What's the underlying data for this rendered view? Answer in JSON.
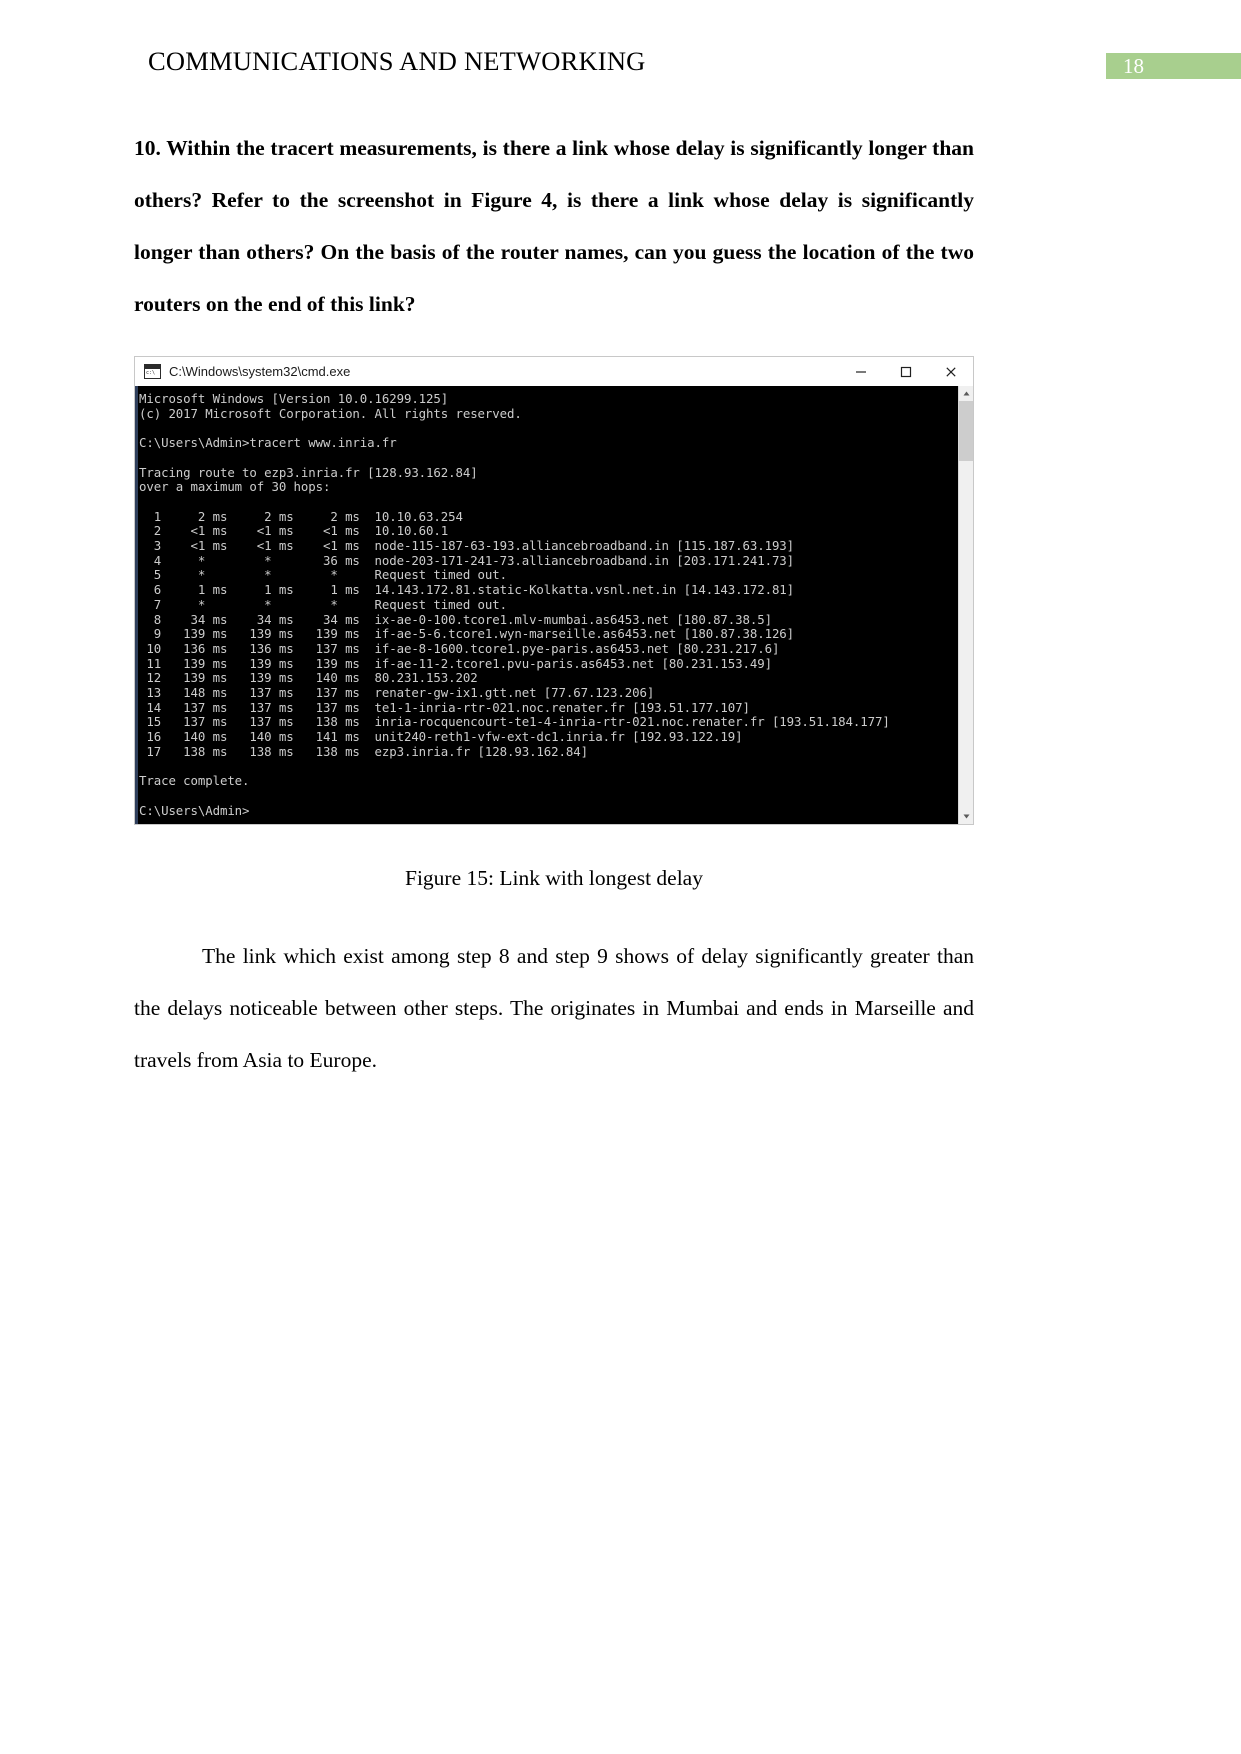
{
  "header": {
    "title": "COMMUNICATIONS AND NETWORKING",
    "page_number": "18",
    "badge_color": "#a8cf8e"
  },
  "question": {
    "text": "10. Within the tracert measurements, is there a link whose delay is significantly longer than others? Refer to the screenshot in Figure 4, is there a link whose delay is significantly longer than others? On the basis of the router names, can you guess the location of the two routers on the end of this link?"
  },
  "terminal": {
    "titlebar": {
      "icon": "cmd-icon",
      "title": "C:\\Windows\\system32\\cmd.exe",
      "minimize_label": "—",
      "maximize_label": "□",
      "close_label": "✕"
    },
    "console_text": "Microsoft Windows [Version 10.0.16299.125]\n(c) 2017 Microsoft Corporation. All rights reserved.\n\nC:\\Users\\Admin>tracert www.inria.fr\n\nTracing route to ezp3.inria.fr [128.93.162.84]\nover a maximum of 30 hops:\n\n  1     2 ms     2 ms     2 ms  10.10.63.254\n  2    <1 ms    <1 ms    <1 ms  10.10.60.1\n  3    <1 ms    <1 ms    <1 ms  node-115-187-63-193.alliancebroadband.in [115.187.63.193]\n  4     *        *       36 ms  node-203-171-241-73.alliancebroadband.in [203.171.241.73]\n  5     *        *        *     Request timed out.\n  6     1 ms     1 ms     1 ms  14.143.172.81.static-Kolkatta.vsnl.net.in [14.143.172.81]\n  7     *        *        *     Request timed out.\n  8    34 ms    34 ms    34 ms  ix-ae-0-100.tcore1.mlv-mumbai.as6453.net [180.87.38.5]\n  9   139 ms   139 ms   139 ms  if-ae-5-6.tcore1.wyn-marseille.as6453.net [180.87.38.126]\n 10   136 ms   136 ms   137 ms  if-ae-8-1600.tcore1.pye-paris.as6453.net [80.231.217.6]\n 11   139 ms   139 ms   139 ms  if-ae-11-2.tcore1.pvu-paris.as6453.net [80.231.153.49]\n 12   139 ms   139 ms   140 ms  80.231.153.202\n 13   148 ms   137 ms   137 ms  renater-gw-ix1.gtt.net [77.67.123.206]\n 14   137 ms   137 ms   137 ms  te1-1-inria-rtr-021.noc.renater.fr [193.51.177.107]\n 15   137 ms   137 ms   138 ms  inria-rocquencourt-te1-4-inria-rtr-021.noc.renater.fr [193.51.184.177]\n 16   140 ms   140 ms   141 ms  unit240-reth1-vfw-ext-dc1.inria.fr [192.93.122.19]\n 17   138 ms   138 ms   138 ms  ezp3.inria.fr [128.93.162.84]\n\nTrace complete.\n\nC:\\Users\\Admin>",
    "hops": [
      {
        "hop": "1",
        "rtt1": "2 ms",
        "rtt2": "2 ms",
        "rtt3": "2 ms",
        "host": "10.10.63.254"
      },
      {
        "hop": "2",
        "rtt1": "<1 ms",
        "rtt2": "<1 ms",
        "rtt3": "<1 ms",
        "host": "10.10.60.1"
      },
      {
        "hop": "3",
        "rtt1": "<1 ms",
        "rtt2": "<1 ms",
        "rtt3": "<1 ms",
        "host": "node-115-187-63-193.alliancebroadband.in [115.187.63.193]"
      },
      {
        "hop": "4",
        "rtt1": "*",
        "rtt2": "*",
        "rtt3": "36 ms",
        "host": "node-203-171-241-73.alliancebroadband.in [203.171.241.73]"
      },
      {
        "hop": "5",
        "rtt1": "*",
        "rtt2": "*",
        "rtt3": "*",
        "host": "Request timed out."
      },
      {
        "hop": "6",
        "rtt1": "1 ms",
        "rtt2": "1 ms",
        "rtt3": "1 ms",
        "host": "14.143.172.81.static-Kolkatta.vsnl.net.in [14.143.172.81]"
      },
      {
        "hop": "7",
        "rtt1": "*",
        "rtt2": "*",
        "rtt3": "*",
        "host": "Request timed out."
      },
      {
        "hop": "8",
        "rtt1": "34 ms",
        "rtt2": "34 ms",
        "rtt3": "34 ms",
        "host": "ix-ae-0-100.tcore1.mlv-mumbai.as6453.net [180.87.38.5]"
      },
      {
        "hop": "9",
        "rtt1": "139 ms",
        "rtt2": "139 ms",
        "rtt3": "139 ms",
        "host": "if-ae-5-6.tcore1.wyn-marseille.as6453.net [180.87.38.126]"
      },
      {
        "hop": "10",
        "rtt1": "136 ms",
        "rtt2": "136 ms",
        "rtt3": "137 ms",
        "host": "if-ae-8-1600.tcore1.pye-paris.as6453.net [80.231.217.6]"
      },
      {
        "hop": "11",
        "rtt1": "139 ms",
        "rtt2": "139 ms",
        "rtt3": "139 ms",
        "host": "if-ae-11-2.tcore1.pvu-paris.as6453.net [80.231.153.49]"
      },
      {
        "hop": "12",
        "rtt1": "139 ms",
        "rtt2": "139 ms",
        "rtt3": "140 ms",
        "host": "80.231.153.202"
      },
      {
        "hop": "13",
        "rtt1": "148 ms",
        "rtt2": "137 ms",
        "rtt3": "137 ms",
        "host": "renater-gw-ix1.gtt.net [77.67.123.206]"
      },
      {
        "hop": "14",
        "rtt1": "137 ms",
        "rtt2": "137 ms",
        "rtt3": "137 ms",
        "host": "te1-1-inria-rtr-021.noc.renater.fr [193.51.177.107]"
      },
      {
        "hop": "15",
        "rtt1": "137 ms",
        "rtt2": "137 ms",
        "rtt3": "138 ms",
        "host": "inria-rocquencourt-te1-4-inria-rtr-021.noc.renater.fr [193.51.184.177]"
      },
      {
        "hop": "16",
        "rtt1": "140 ms",
        "rtt2": "140 ms",
        "rtt3": "141 ms",
        "host": "unit240-reth1-vfw-ext-dc1.inria.fr [192.93.122.19]"
      },
      {
        "hop": "17",
        "rtt1": "138 ms",
        "rtt2": "138 ms",
        "rtt3": "138 ms",
        "host": "ezp3.inria.fr [128.93.162.84]"
      }
    ],
    "command": "tracert www.inria.fr",
    "prompt": "C:\\Users\\Admin>",
    "trace_status": "Trace complete."
  },
  "figure": {
    "caption": "Figure 15: Link with longest delay"
  },
  "answer": {
    "text": "The link which exist among step 8 and step 9 shows of delay significantly greater than the delays noticeable between other steps. The originates in Mumbai and ends in Marseille and travels from Asia to Europe."
  }
}
